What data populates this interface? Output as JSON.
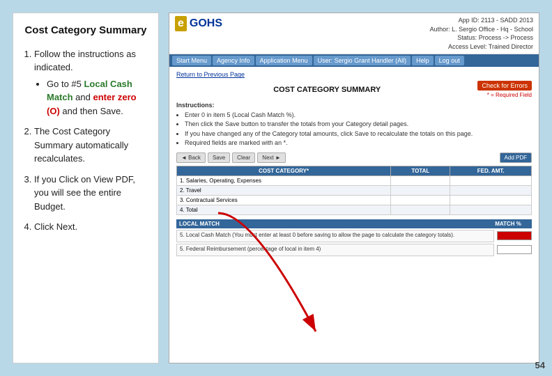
{
  "page": {
    "background_color": "#b8d8e8",
    "page_number": "54"
  },
  "left_panel": {
    "title": "Cost Category Summary",
    "steps": [
      {
        "id": 1,
        "text": "Follow the instructions as indicated."
      },
      {
        "id": 2,
        "text": "The Cost Category Summary automatically recalculates."
      },
      {
        "id": 3,
        "text": "If you Click on View PDF, you will see the entire Budget."
      },
      {
        "id": 4,
        "text": "Click Next."
      }
    ],
    "bullet": {
      "prefix": "Go to #5 ",
      "green_text": "Local Cash Match",
      "middle": " and ",
      "red_text": "enter zero (O)",
      "suffix": " and then Save."
    }
  },
  "egohs": {
    "logo_e": "e",
    "logo_gohs": "GOHS",
    "header_info": {
      "line1": "App ID: 2113 - SADD 2013",
      "line2": "Author: L. Sergio Office - Hq - School",
      "line3": "Status: Process -> Process",
      "line4": "Access Level: Trained Director"
    },
    "nav_items": [
      "Start Menu",
      "Agency Info",
      "Application Menu",
      "User: Sergio  Grant Handler (All)",
      "Help",
      "Log out"
    ],
    "content": {
      "return_link": "Return to Previous Page",
      "title": "COST CATEGORY SUMMARY",
      "check_errors_btn": "Check for Errors",
      "required_field_note": "* = Required Field",
      "instructions": {
        "label": "Instructions:",
        "items": [
          "Enter 0 in item 5 (Local Cash Match %).",
          "Then click the Save button to transfer the totals from your Category detail pages.",
          "If you have changed any of the Category total amounts, click Save to recalculate the totals on this page.",
          "Required fields are marked with an *."
        ]
      },
      "nav_buttons": [
        "Back",
        "Save",
        "Clear",
        "Next",
        "Add PDF"
      ],
      "table": {
        "headers": [
          "COST CATEGORY*",
          "TOTAL",
          "FED. AMT."
        ],
        "rows": [
          {
            "category": "1. Salaries, Operating, Expenses",
            "total": "",
            "fed_amt": ""
          },
          {
            "category": "2. Travel",
            "total": "",
            "fed_amt": ""
          },
          {
            "category": "3. Contractual Services",
            "total": "",
            "fed_amt": ""
          },
          {
            "category": "4. Total",
            "total": "",
            "fed_amt": ""
          }
        ]
      },
      "local_match": {
        "header_cols": [
          "LOCAL MATCH",
          "",
          "MATCH %"
        ],
        "rows": [
          {
            "label": "5. Local Cash Match (You must enter at least 0 before saving to allow the page to calculate the category totals).",
            "input_value": "",
            "input_highlight": true
          },
          {
            "label": "5. Federal Reimbursement (percentage of local in item 4)",
            "input_value": "",
            "input_highlight": false
          }
        ]
      }
    }
  }
}
